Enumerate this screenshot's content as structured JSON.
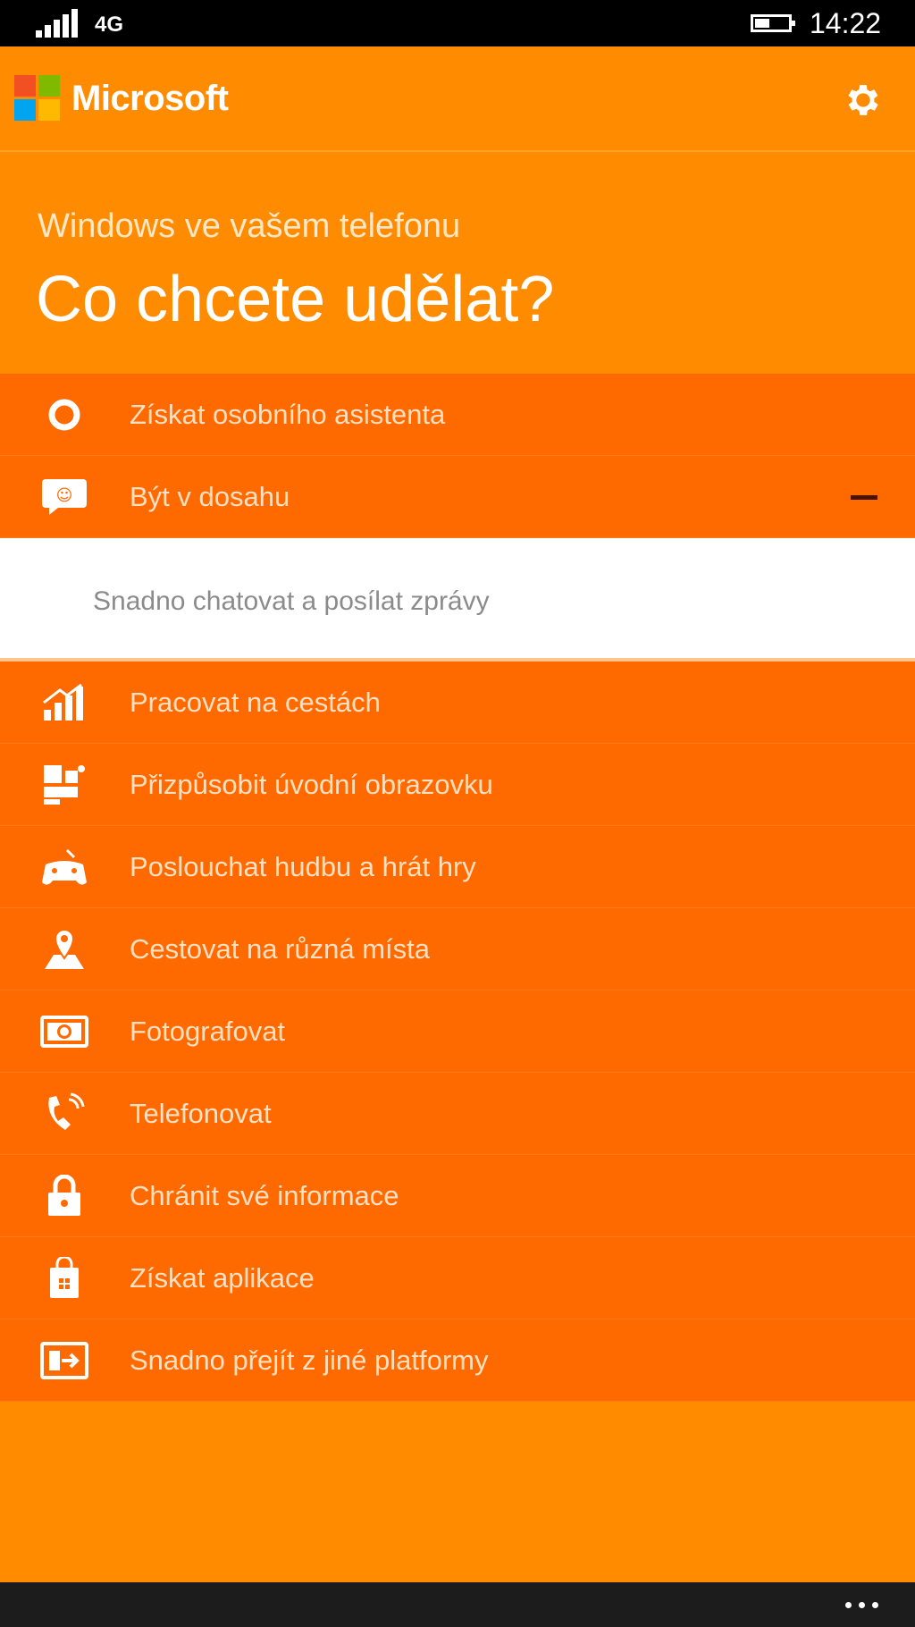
{
  "status_bar": {
    "network": "4G",
    "time": "14:22",
    "battery_level": 0.45
  },
  "header": {
    "brand": "Microsoft",
    "settings_icon": "gear-icon"
  },
  "hero": {
    "subtitle": "Windows ve vašem telefonu",
    "title": "Co chcete udělat?"
  },
  "colors": {
    "background": "#ff8c00",
    "list_item": "#ff6a00",
    "label_text": "#ffe0c2",
    "expanded_bg": "#ffffff"
  },
  "menu": {
    "items": [
      {
        "label": "Získat osobního asistenta",
        "icon": "cortana-icon"
      },
      {
        "label": "Být v dosahu",
        "icon": "chat-icon",
        "expanded": true,
        "sub_items": [
          "Snadno chatovat a posílat zprávy"
        ]
      },
      {
        "label": "Pracovat na cestách",
        "icon": "office-chart-icon"
      },
      {
        "label": "Přizpůsobit úvodní obrazovku",
        "icon": "start-tiles-icon"
      },
      {
        "label": "Poslouchat hudbu a hrát hry",
        "icon": "gamepad-icon"
      },
      {
        "label": "Cestovat na různá místa",
        "icon": "map-pin-icon"
      },
      {
        "label": "Fotografovat",
        "icon": "camera-icon"
      },
      {
        "label": "Telefonovat",
        "icon": "phone-icon"
      },
      {
        "label": "Chránit své informace",
        "icon": "lock-icon"
      },
      {
        "label": "Získat aplikace",
        "icon": "store-bag-icon"
      },
      {
        "label": "Snadno přejít z jiné platformy",
        "icon": "transfer-icon"
      }
    ]
  },
  "app_bar": {
    "more_icon": "more-dots-icon"
  }
}
